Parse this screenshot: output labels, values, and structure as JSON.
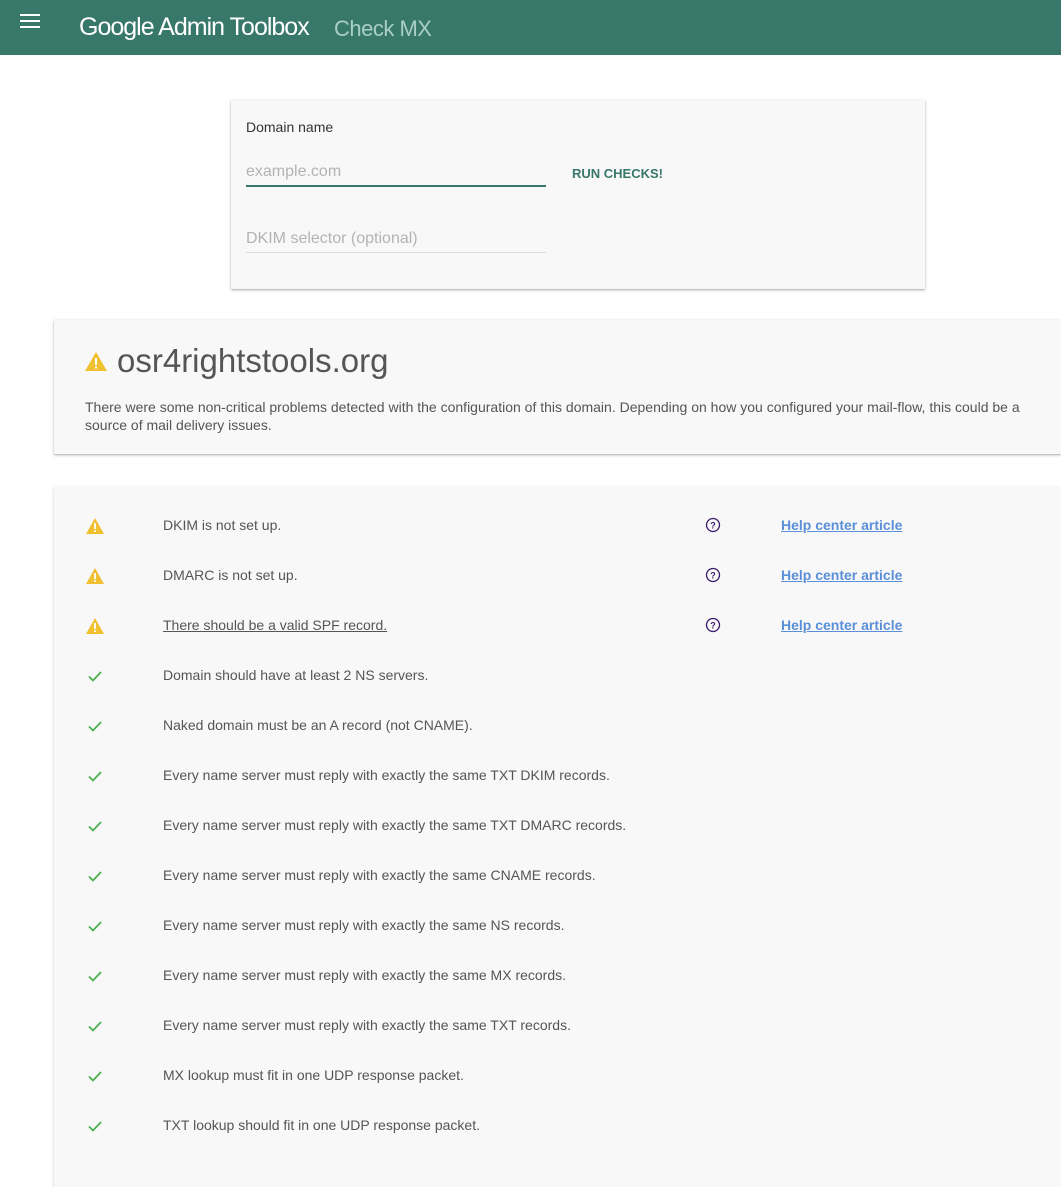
{
  "appbar": {
    "brand": "Google Admin Toolbox",
    "tool": "Check MX",
    "menu_icon": "menu-icon",
    "background": "#38786a"
  },
  "search": {
    "domain_label": "Domain name",
    "domain_placeholder": "example.com",
    "domain_value": "",
    "dkim_placeholder": "DKIM selector (optional)",
    "dkim_value": "",
    "run_label": "RUN CHECKS!"
  },
  "summary": {
    "status_icon": "warning-icon",
    "domain": "osr4rightstools.org",
    "message": "There were some non-critical problems detected with the configuration of this domain. Depending on how you configured your mail-flow, this could be a source of mail delivery issues."
  },
  "colors": {
    "accent": "#38786a",
    "warning": "#f0c030",
    "success": "#4caf50",
    "link": "#5b8fd8",
    "help_icon": "#3a1a6a"
  },
  "results": [
    {
      "status": "warning",
      "icon": "warning-icon",
      "text": "DKIM is not set up.",
      "linked": false,
      "help_icon": "help-circle-icon",
      "help_link": "Help center article"
    },
    {
      "status": "warning",
      "icon": "warning-icon",
      "text": "DMARC is not set up.",
      "linked": false,
      "help_icon": "help-circle-icon",
      "help_link": "Help center article"
    },
    {
      "status": "warning",
      "icon": "warning-icon",
      "text": "There should be a valid SPF record.",
      "linked": true,
      "help_icon": "help-circle-icon",
      "help_link": "Help center article"
    },
    {
      "status": "ok",
      "icon": "check-icon",
      "text": "Domain should have at least 2 NS servers."
    },
    {
      "status": "ok",
      "icon": "check-icon",
      "text": "Naked domain must be an A record (not CNAME)."
    },
    {
      "status": "ok",
      "icon": "check-icon",
      "text": "Every name server must reply with exactly the same TXT DKIM records."
    },
    {
      "status": "ok",
      "icon": "check-icon",
      "text": "Every name server must reply with exactly the same TXT DMARC records."
    },
    {
      "status": "ok",
      "icon": "check-icon",
      "text": "Every name server must reply with exactly the same CNAME records."
    },
    {
      "status": "ok",
      "icon": "check-icon",
      "text": "Every name server must reply with exactly the same NS records."
    },
    {
      "status": "ok",
      "icon": "check-icon",
      "text": "Every name server must reply with exactly the same MX records."
    },
    {
      "status": "ok",
      "icon": "check-icon",
      "text": "Every name server must reply with exactly the same TXT records."
    },
    {
      "status": "ok",
      "icon": "check-icon",
      "text": "MX lookup must fit in one UDP response packet."
    },
    {
      "status": "ok",
      "icon": "check-icon",
      "text": "TXT lookup should fit in one UDP response packet."
    }
  ]
}
